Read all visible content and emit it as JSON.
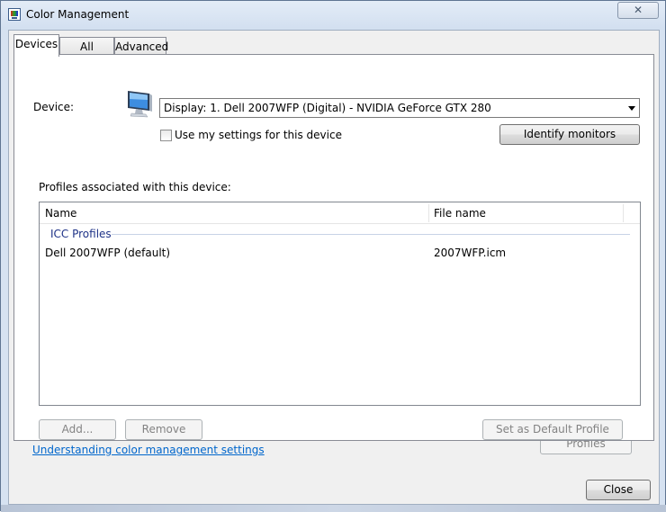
{
  "window": {
    "title": "Color Management",
    "close_glyph": "✕"
  },
  "tabs": [
    {
      "label": "Devices"
    },
    {
      "label": "All Profiles"
    },
    {
      "label": "Advanced"
    }
  ],
  "device": {
    "label": "Device:",
    "selected": "Display: 1. Dell 2007WFP (Digital) - NVIDIA GeForce GTX 280",
    "icon": "monitor-icon"
  },
  "use_settings": {
    "label": "Use my settings for this device",
    "checked": false
  },
  "identify_button": "Identify monitors",
  "profiles_label": "Profiles associated with this device:",
  "profiles_table": {
    "columns": [
      "Name",
      "File name"
    ],
    "group": "ICC Profiles",
    "rows": [
      {
        "name": "Dell 2007WFP (default)",
        "file": "2007WFP.icm"
      }
    ]
  },
  "buttons": {
    "add": "Add...",
    "remove": "Remove",
    "set_default": "Set as Default Profile",
    "profiles": "Profiles",
    "close": "Close"
  },
  "link": "Understanding color management settings"
}
